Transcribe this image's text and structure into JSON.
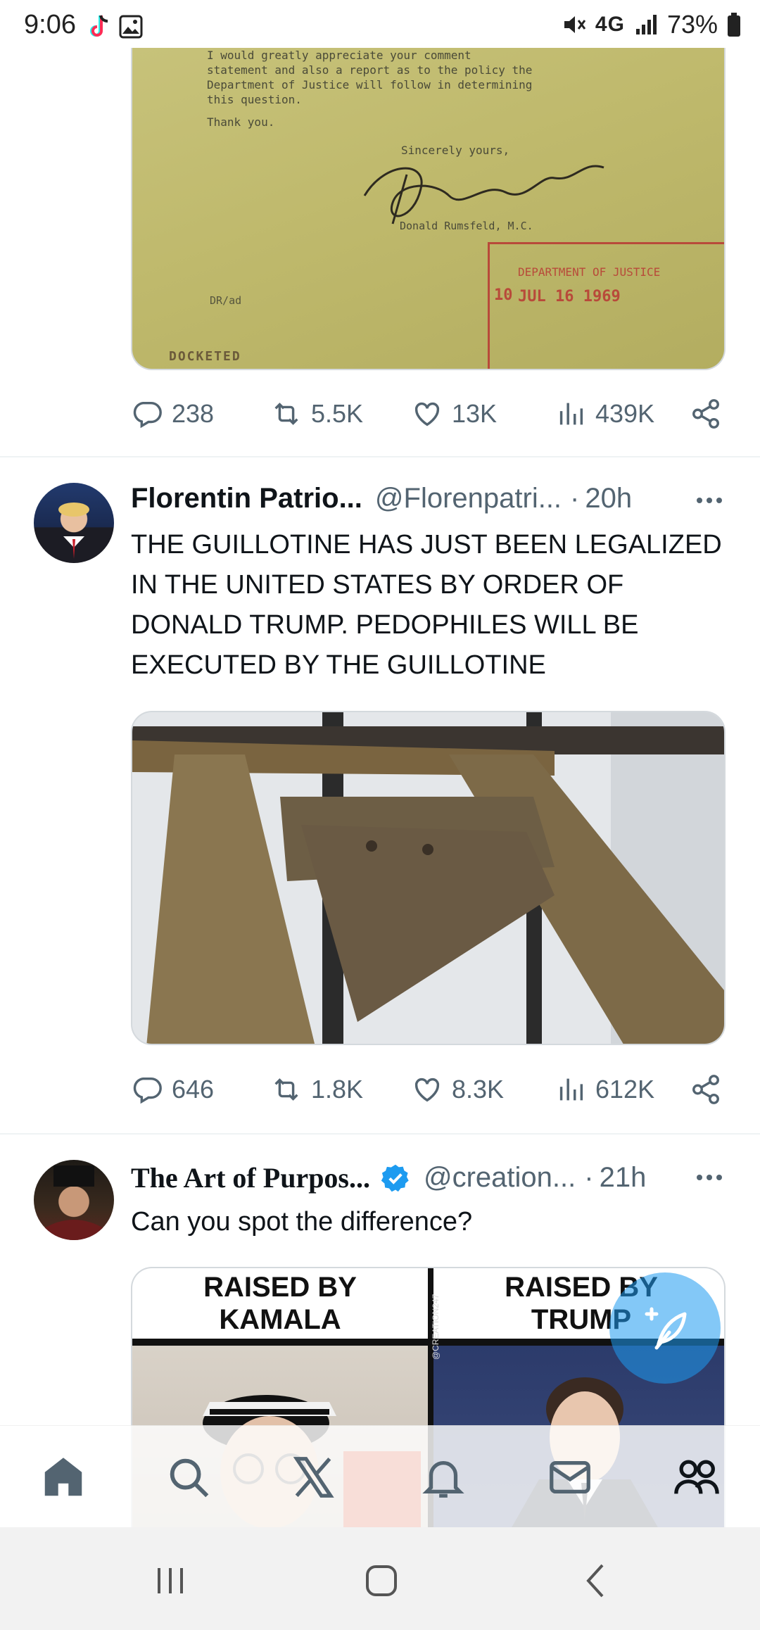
{
  "status_bar": {
    "time": "9:06",
    "network": "4G",
    "battery": "73%"
  },
  "tweet1": {
    "doc": {
      "line1": "I would greatly appreciate your comment",
      "line2": "statement and also a report as to the policy the",
      "line3": "Department of Justice will follow in determining",
      "line4": "this question.",
      "thanks": "Thank you.",
      "sincerely": "Sincerely yours,",
      "name": "Donald Rumsfeld, M.C.",
      "stamp_dept": "DEPARTMENT OF JUSTICE",
      "stamp_date": "JUL 16 1969",
      "stamp_num": "10",
      "mark": "DR/ad",
      "docketed": "DOCKETED"
    },
    "stats": {
      "replies": "238",
      "reposts": "5.5K",
      "likes": "13K",
      "views": "439K"
    }
  },
  "tweet2": {
    "name": "Florentin Patrio...",
    "handle": "@Florenpatri...",
    "dot": "·",
    "time": "20h",
    "text": "THE GUILLOTINE HAS JUST BEEN LEGALIZED IN THE UNITED STATES BY ORDER OF DONALD TRUMP. PEDOPHILES WILL BE EXECUTED BY THE GUILLOTINE",
    "stats": {
      "replies": "646",
      "reposts": "1.8K",
      "likes": "8.3K",
      "views": "612K"
    }
  },
  "tweet3": {
    "name": "The Art of Purpos...",
    "handle": "@creation...",
    "dot": "·",
    "time": "21h",
    "text": "Can you spot the difference?",
    "compare": {
      "left_line1": "RAISED BY",
      "left_line2": "KAMALA",
      "right_line1": "RAISED BY",
      "right_line2": "TRUMP",
      "watermark": "@CREATION247"
    }
  },
  "colors": {
    "accent": "#1d9bf0",
    "text_primary": "#0f1419",
    "text_secondary": "#536471"
  },
  "icons": {
    "nav": [
      "home-icon",
      "search-icon",
      "x-logo-icon",
      "bell-icon",
      "mail-icon",
      "communities-icon"
    ],
    "system": [
      "recents-icon",
      "home-button-icon",
      "back-icon"
    ]
  }
}
